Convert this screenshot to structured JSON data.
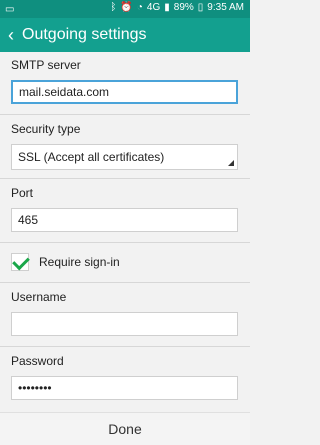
{
  "status_bar": {
    "time": "9:35 AM",
    "battery": "89%",
    "network": "4G"
  },
  "app_bar": {
    "title": "Outgoing settings"
  },
  "form": {
    "smtp_server_label": "SMTP server",
    "smtp_server_value": "mail.seidata.com",
    "security_type_label": "Security type",
    "security_type_value": "SSL (Accept all certificates)",
    "port_label": "Port",
    "port_value": "465",
    "require_signin_label": "Require sign-in",
    "require_signin_checked": true,
    "username_label": "Username",
    "username_value": "",
    "password_label": "Password",
    "password_value": "••••••••"
  },
  "footer": {
    "done_label": "Done"
  },
  "colors": {
    "status_bar": "#0f8f7f",
    "app_bar": "#13a08f",
    "checkmark": "#1aa74a",
    "active_field_border": "#4aa3d9"
  }
}
